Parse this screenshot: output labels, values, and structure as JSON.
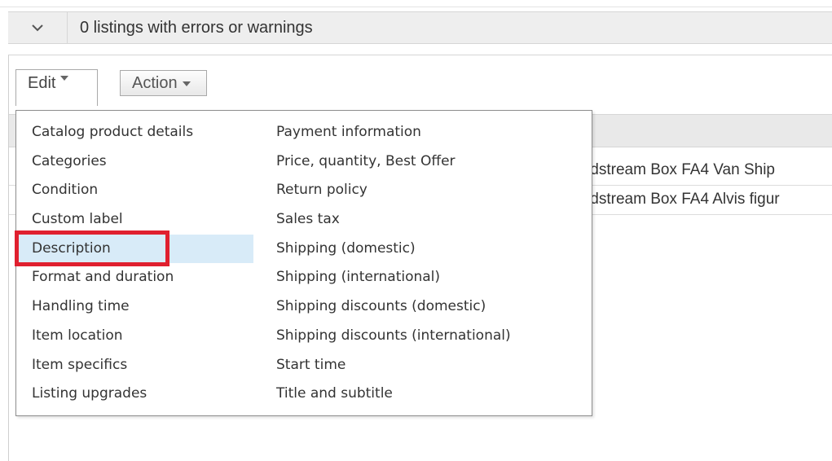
{
  "status_bar": {
    "text": "0 listings with errors or warnings",
    "expand_icon": "chevron-down-icon"
  },
  "toolbar": {
    "edit_label": "Edit",
    "action_label": "Action"
  },
  "listings": [
    {
      "title_fragment": "ıdstream Box FA4 Van Ship"
    },
    {
      "title_fragment": "ıdstream Box FA4 Alvis figur"
    }
  ],
  "edit_menu": {
    "left_items": [
      "Catalog product details",
      "Categories",
      "Condition",
      "Custom label",
      "Description",
      "Format and duration",
      "Handling time",
      "Item location",
      "Item specifics",
      "Listing upgrades"
    ],
    "right_items": [
      "Payment information",
      "Price, quantity, Best Offer",
      "Return policy",
      "Sales tax",
      "Shipping (domestic)",
      "Shipping (international)",
      "Shipping discounts (domestic)",
      "Shipping discounts (international)",
      "Start time",
      "Title and subtitle"
    ],
    "selected": "Description"
  },
  "colors": {
    "highlight_border": "#e0202f",
    "selected_bg": "#d8ebf8"
  }
}
